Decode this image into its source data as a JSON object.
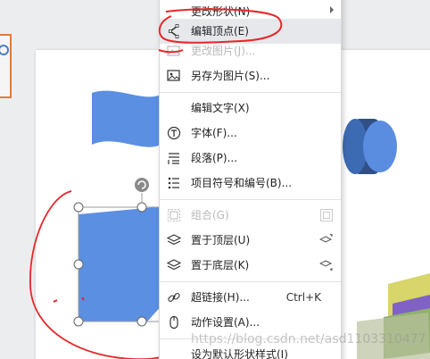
{
  "menu": {
    "items": [
      {
        "label": "更改形状(N)",
        "icon": "change-shape-icon",
        "disabled": false,
        "submenu": true
      },
      {
        "label": "编辑顶点(E)",
        "icon": "edit-points-icon",
        "disabled": false,
        "highlighted": true
      },
      {
        "label": "更改图片(J)...",
        "icon": "change-picture-icon",
        "disabled": true
      },
      {
        "label": "另存为图片(S)...",
        "icon": "save-as-picture-icon",
        "disabled": false
      },
      {
        "label": "编辑文字(X)",
        "icon": "",
        "disabled": false
      },
      {
        "label": "字体(F)...",
        "icon": "font-icon",
        "disabled": false
      },
      {
        "label": "段落(P)...",
        "icon": "paragraph-icon",
        "disabled": false
      },
      {
        "label": "项目符号和编号(B)...",
        "icon": "bullets-icon",
        "disabled": false
      },
      {
        "label": "组合(G)",
        "icon": "group-icon",
        "disabled": true
      },
      {
        "label": "置于顶层(U)",
        "icon": "bring-to-front-icon",
        "disabled": false
      },
      {
        "label": "置于底层(K)",
        "icon": "send-to-back-icon",
        "disabled": false
      },
      {
        "label": "超链接(H)...",
        "icon": "hyperlink-icon",
        "disabled": false,
        "shortcut": "Ctrl+K"
      },
      {
        "label": "动作设置(A)...",
        "icon": "action-settings-icon",
        "disabled": false
      },
      {
        "label": "设为默认形状样式(I)",
        "icon": "",
        "disabled": false
      }
    ]
  },
  "watermark": "https://blog.csdn.net/asd1103310477",
  "colors": {
    "shape_fill": "#5b8fe2",
    "annotation": "#e8262a",
    "menu_highlight": "#e6e8eb"
  }
}
